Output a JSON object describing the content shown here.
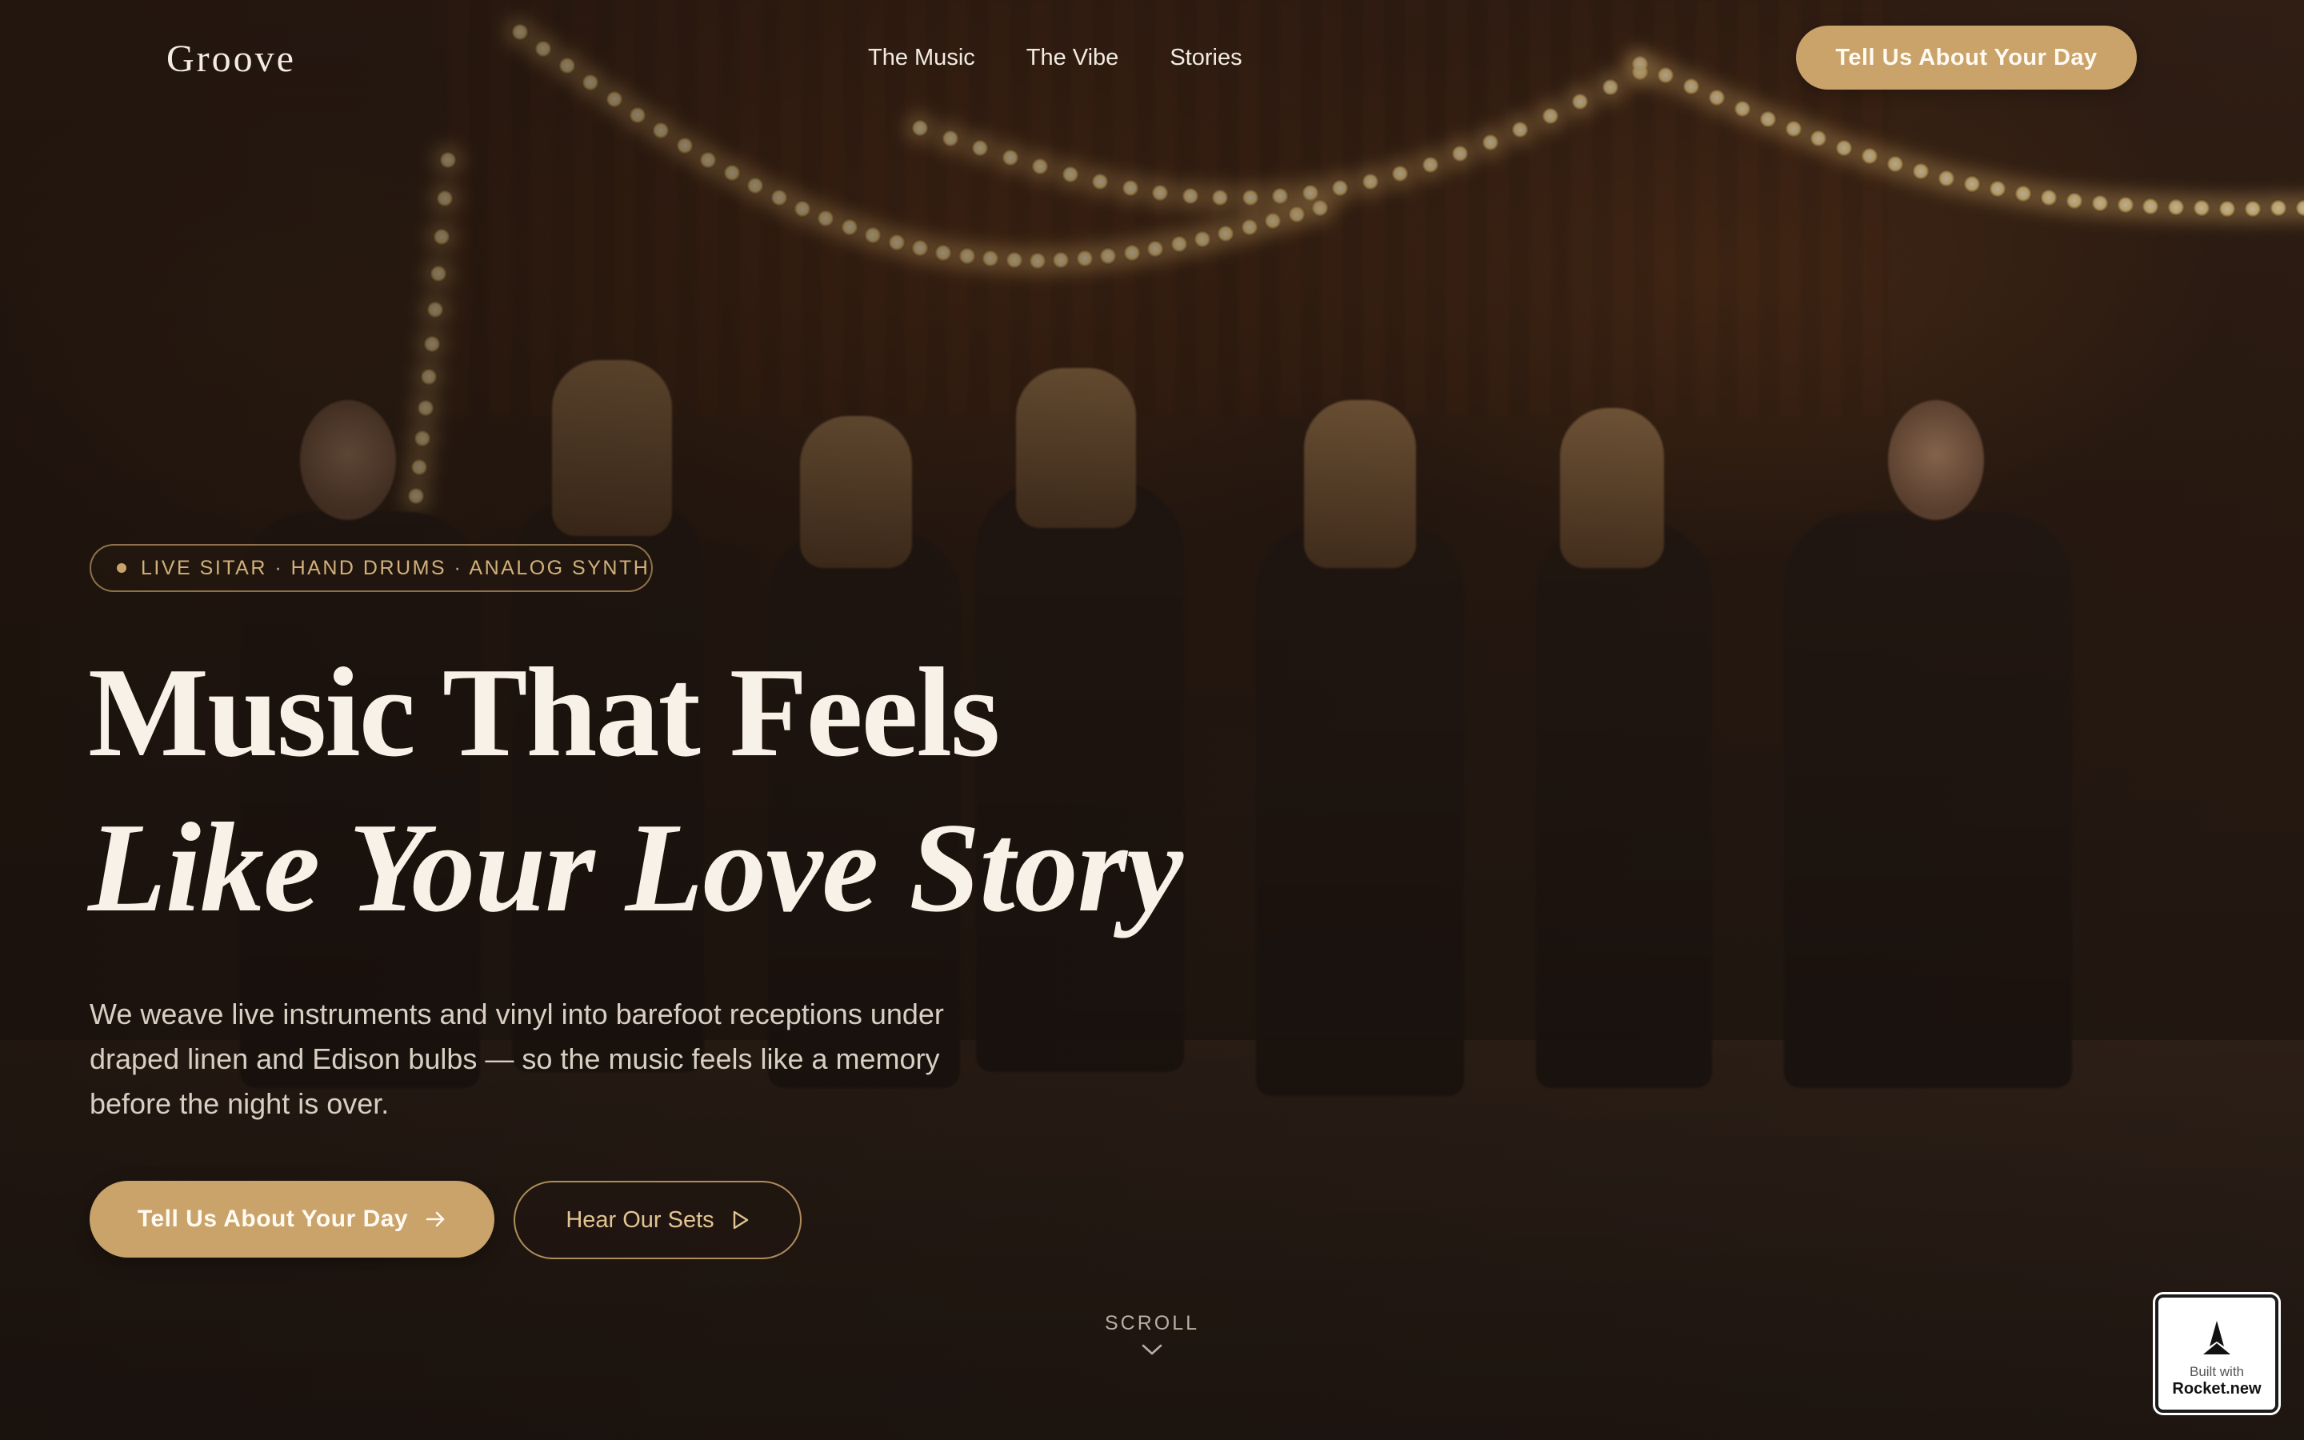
{
  "header": {
    "logo": "Groove",
    "nav": [
      "The Music",
      "The Vibe",
      "Stories"
    ],
    "cta_label": "Tell Us About Your Day"
  },
  "hero": {
    "badge": "LIVE SITAR · HAND DRUMS · ANALOG SYNTH",
    "headline_line1": "Music That Feels",
    "headline_line2": "Like Your Love Story",
    "lede": "We weave live instruments and vinyl into barefoot receptions under draped linen and Edison bulbs — so the music feels like a memory before the night is over.",
    "primary_cta": "Tell Us About Your Day",
    "primary_icon": "arrow-right-icon",
    "secondary_cta": "Hear Our Sets",
    "secondary_icon": "play-icon",
    "scroll_label": "SCROLL",
    "scroll_icon": "chevron-down-icon"
  },
  "badge_widget": {
    "built_with": "Built with",
    "brand": "Rocket.new"
  },
  "colors": {
    "accent": "#c9a36a",
    "text_light": "#f3ece2",
    "background": "#1d140e"
  }
}
